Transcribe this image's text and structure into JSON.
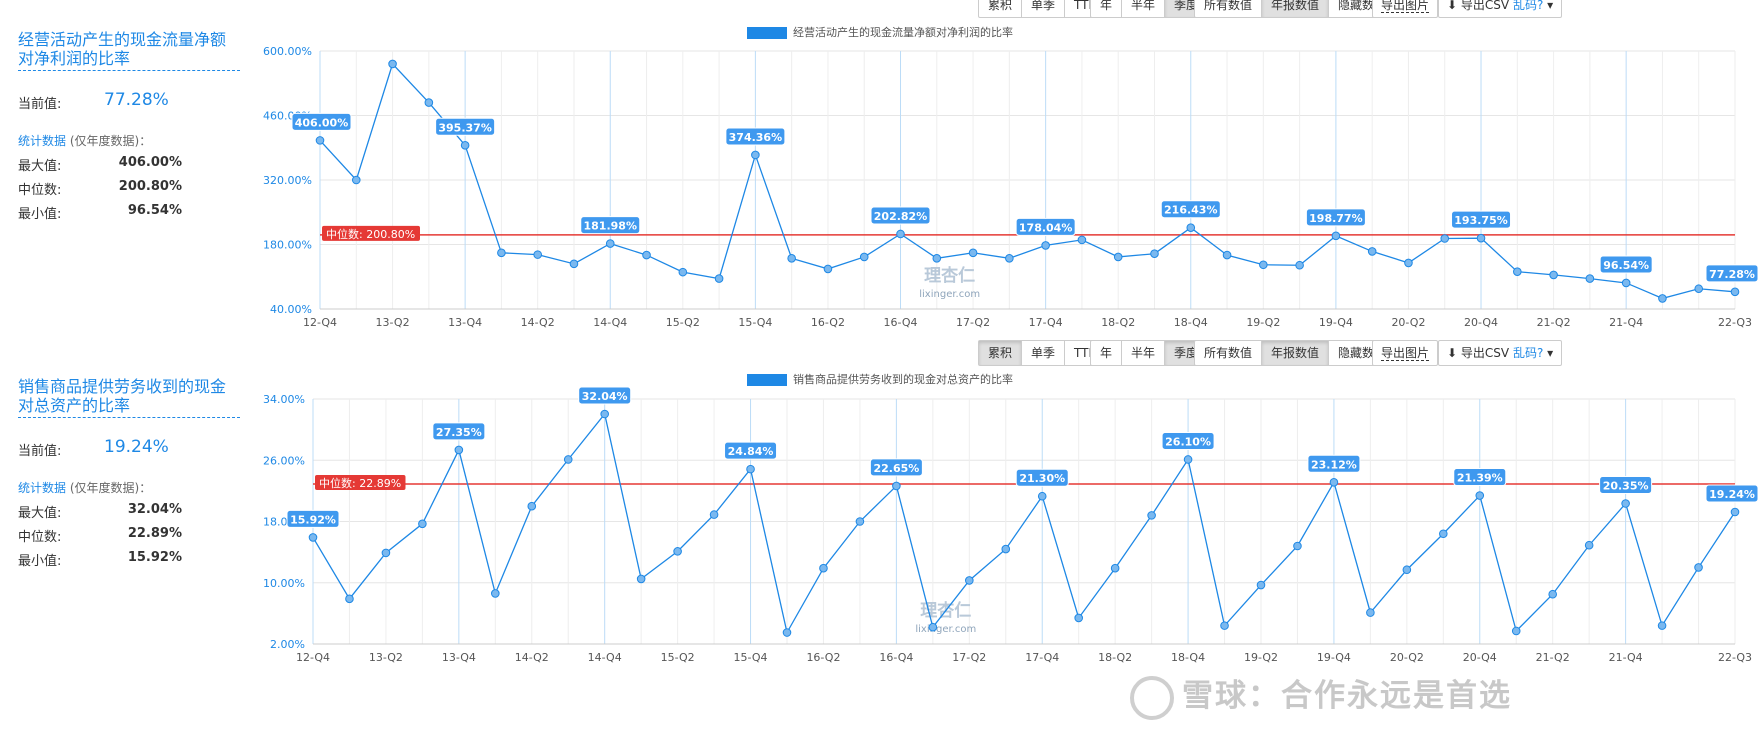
{
  "toolbar": {
    "mode": [
      "累积",
      "单季",
      "TTM"
    ],
    "period": [
      "年",
      "半年",
      "季度"
    ],
    "data": [
      "所有数值",
      "年报数值",
      "隐藏数值"
    ],
    "export_image": "导出图片",
    "export_csv": "导出CSV",
    "garbled": "乱码?"
  },
  "watermarks": {
    "site_cn": "理杏仁",
    "site_en": "lixinger.com",
    "xueqiu": "雪球：合作永远是首选"
  },
  "colors": {
    "line": "#1e88e5",
    "median": "#e53935",
    "grid": "#e6e6e6"
  },
  "panels": [
    {
      "title": "经营活动产生的现金流量净额对净利润的比率",
      "current_label": "当前值:",
      "current_value": "77.28%",
      "stats_link": "统计数据",
      "stats_note": "(仅年度数据)：",
      "max_label": "最大值:",
      "max_value": "406.00%",
      "median_label": "中位数:",
      "median_value": "200.80%",
      "min_label": "最小值:",
      "min_value": "96.54%"
    },
    {
      "title": "销售商品提供劳务收到的现金对总资产的比率",
      "current_label": "当前值:",
      "current_value": "19.24%",
      "stats_link": "统计数据",
      "stats_note": "(仅年度数据)：",
      "max_label": "最大值:",
      "max_value": "32.04%",
      "median_label": "中位数:",
      "median_value": "22.89%",
      "min_label": "最小值:",
      "min_value": "15.92%"
    }
  ],
  "chart_data": [
    {
      "type": "line",
      "legend": "经营活动产生的现金流量净额对净利润的比率",
      "ylim": [
        40,
        600
      ],
      "yticks": [
        40,
        180,
        320,
        460,
        600
      ],
      "ytick_labels": [
        "40.00%",
        "180.00%",
        "320.00%",
        "460.00%",
        "600.00%"
      ],
      "x_tick_labels": [
        "12-Q4",
        "13-Q2",
        "13-Q4",
        "14-Q2",
        "14-Q4",
        "15-Q2",
        "15-Q4",
        "16-Q2",
        "16-Q4",
        "17-Q2",
        "17-Q4",
        "18-Q2",
        "18-Q4",
        "19-Q2",
        "19-Q4",
        "20-Q2",
        "20-Q4",
        "21-Q2",
        "21-Q4",
        "22-Q3"
      ],
      "x": [
        "12-Q4",
        "13-Q1",
        "13-Q2",
        "13-Q3",
        "13-Q4",
        "14-Q1",
        "14-Q2",
        "14-Q3",
        "14-Q4",
        "15-Q1",
        "15-Q2",
        "15-Q3",
        "15-Q4",
        "16-Q1",
        "16-Q2",
        "16-Q3",
        "16-Q4",
        "17-Q1",
        "17-Q2",
        "17-Q3",
        "17-Q4",
        "18-Q1",
        "18-Q2",
        "18-Q3",
        "18-Q4",
        "19-Q1",
        "19-Q2",
        "19-Q3",
        "19-Q4",
        "20-Q1",
        "20-Q2",
        "20-Q3",
        "20-Q4",
        "21-Q1",
        "21-Q2",
        "21-Q3",
        "21-Q4",
        "22-Q1",
        "22-Q2",
        "22-Q3"
      ],
      "values": [
        406.0,
        320.0,
        572.0,
        488.0,
        395.37,
        162.0,
        158.0,
        138.0,
        181.98,
        157.0,
        120.0,
        106.0,
        374.36,
        150.0,
        127.0,
        153.0,
        202.82,
        150.0,
        162.0,
        150.0,
        178.04,
        190.0,
        153.0,
        160.0,
        216.43,
        157.0,
        136.0,
        135.0,
        198.77,
        165.0,
        140.0,
        193.0,
        193.75,
        121.0,
        114.0,
        106.0,
        96.54,
        63.0,
        84.0,
        77.28
      ],
      "data_labels": {
        "0": "406.00%",
        "4": "395.37%",
        "8": "181.98%",
        "12": "374.36%",
        "16": "202.82%",
        "20": "178.04%",
        "24": "216.43%",
        "28": "198.77%",
        "32": "193.75%",
        "36": "96.54%",
        "39": "77.28%"
      },
      "median": 200.8,
      "median_label": "中位数: 200.80%",
      "grid": true,
      "legend_position": "top-center"
    },
    {
      "type": "line",
      "legend": "销售商品提供劳务收到的现金对总资产的比率",
      "ylim": [
        2,
        34
      ],
      "yticks": [
        2,
        10,
        18,
        26,
        34
      ],
      "ytick_labels": [
        "2.00%",
        "10.00%",
        "18.00%",
        "26.00%",
        "34.00%"
      ],
      "x_tick_labels": [
        "12-Q4",
        "13-Q2",
        "13-Q4",
        "14-Q2",
        "14-Q4",
        "15-Q2",
        "15-Q4",
        "16-Q2",
        "16-Q4",
        "17-Q2",
        "17-Q4",
        "18-Q2",
        "18-Q4",
        "19-Q2",
        "19-Q4",
        "20-Q2",
        "20-Q4",
        "21-Q2",
        "21-Q4",
        "22-Q3"
      ],
      "x": [
        "12-Q4",
        "13-Q1",
        "13-Q2",
        "13-Q3",
        "13-Q4",
        "14-Q1",
        "14-Q2",
        "14-Q3",
        "14-Q4",
        "15-Q1",
        "15-Q2",
        "15-Q3",
        "15-Q4",
        "16-Q1",
        "16-Q2",
        "16-Q3",
        "16-Q4",
        "17-Q1",
        "17-Q2",
        "17-Q3",
        "17-Q4",
        "18-Q1",
        "18-Q2",
        "18-Q3",
        "18-Q4",
        "19-Q1",
        "19-Q2",
        "19-Q3",
        "19-Q4",
        "20-Q1",
        "20-Q2",
        "20-Q3",
        "20-Q4",
        "21-Q1",
        "21-Q2",
        "21-Q3",
        "21-Q4",
        "22-Q1",
        "22-Q2",
        "22-Q3"
      ],
      "values": [
        15.92,
        7.9,
        13.9,
        17.7,
        27.35,
        8.6,
        20.0,
        26.1,
        32.04,
        10.5,
        14.1,
        18.9,
        24.84,
        3.5,
        11.9,
        18.0,
        22.65,
        4.2,
        10.3,
        14.4,
        21.3,
        5.4,
        11.9,
        18.8,
        26.1,
        4.4,
        9.7,
        14.8,
        23.12,
        6.1,
        11.7,
        16.4,
        21.39,
        3.7,
        8.5,
        14.9,
        20.35,
        4.4,
        12.0,
        19.24
      ],
      "data_labels": {
        "0": "15.92%",
        "4": "27.35%",
        "8": "32.04%",
        "12": "24.84%",
        "16": "22.65%",
        "20": "21.30%",
        "24": "26.10%",
        "28": "23.12%",
        "32": "21.39%",
        "36": "20.35%",
        "39": "19.24%"
      },
      "median": 22.89,
      "median_label": "中位数: 22.89%",
      "grid": true,
      "legend_position": "top-center"
    }
  ]
}
